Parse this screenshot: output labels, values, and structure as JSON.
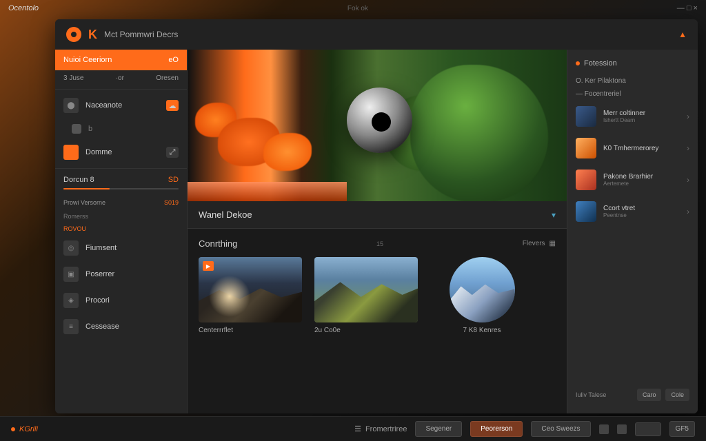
{
  "titlebar": {
    "brand": "Ocentolo",
    "center": "Fok ok",
    "close": "×"
  },
  "header": {
    "k": "K",
    "title": "Mct Pommwri Decrs"
  },
  "sidebar": {
    "active": {
      "label": "Nuioi Ceeriorn",
      "tag": "eO"
    },
    "row2": {
      "left": "3 Juse",
      "mid": "·or",
      "right": "Oresen"
    },
    "items": [
      {
        "label": "Naceanote",
        "badge_orange": true
      },
      {
        "label": "Domme"
      }
    ],
    "duration_label": "Dorcun 8",
    "duration_val": "SD",
    "sub1": "Prowi Versorne",
    "val1": "S019",
    "sub2_label": "Romerss",
    "sub2_link": "ROVOU",
    "list": [
      {
        "label": "Fiumsent"
      },
      {
        "label": "Poserrer"
      },
      {
        "label": "Procori"
      },
      {
        "label": "Cessease"
      }
    ]
  },
  "main": {
    "meta_title": "Wanel Dekoe",
    "section_title": "Conrthing",
    "section_mid": "15",
    "section_action": "Flevers",
    "cards": [
      {
        "caption": "Centerrrflet",
        "sub": ""
      },
      {
        "caption": "2u Co0e",
        "sub": ""
      },
      {
        "caption": "7 K8 Kenres",
        "sub": ""
      }
    ]
  },
  "panel": {
    "title": "Fotession",
    "sub1": "O. Ker Pilaktona",
    "sub2": "— Focentreriel",
    "items": [
      {
        "title": "Merr coltinner",
        "sub": "Ishertt Dearn"
      },
      {
        "title": "K0 Tmhermerorey",
        "sub": ""
      },
      {
        "title": "Pakone Brarhier",
        "sub": "Aertemete"
      },
      {
        "title": "Ccort vtret",
        "sub": "Peentnse"
      }
    ],
    "footer_label": "Iuliv Talese",
    "footer_btn1": "Caro",
    "footer_btn2": "Cole"
  },
  "bottombar": {
    "brand": "KGrili",
    "link": "Fromertriree",
    "btn1": "Segener",
    "btn2": "Peorerson",
    "btn3": "Ceo Sweezs",
    "btn4": "GF5"
  }
}
